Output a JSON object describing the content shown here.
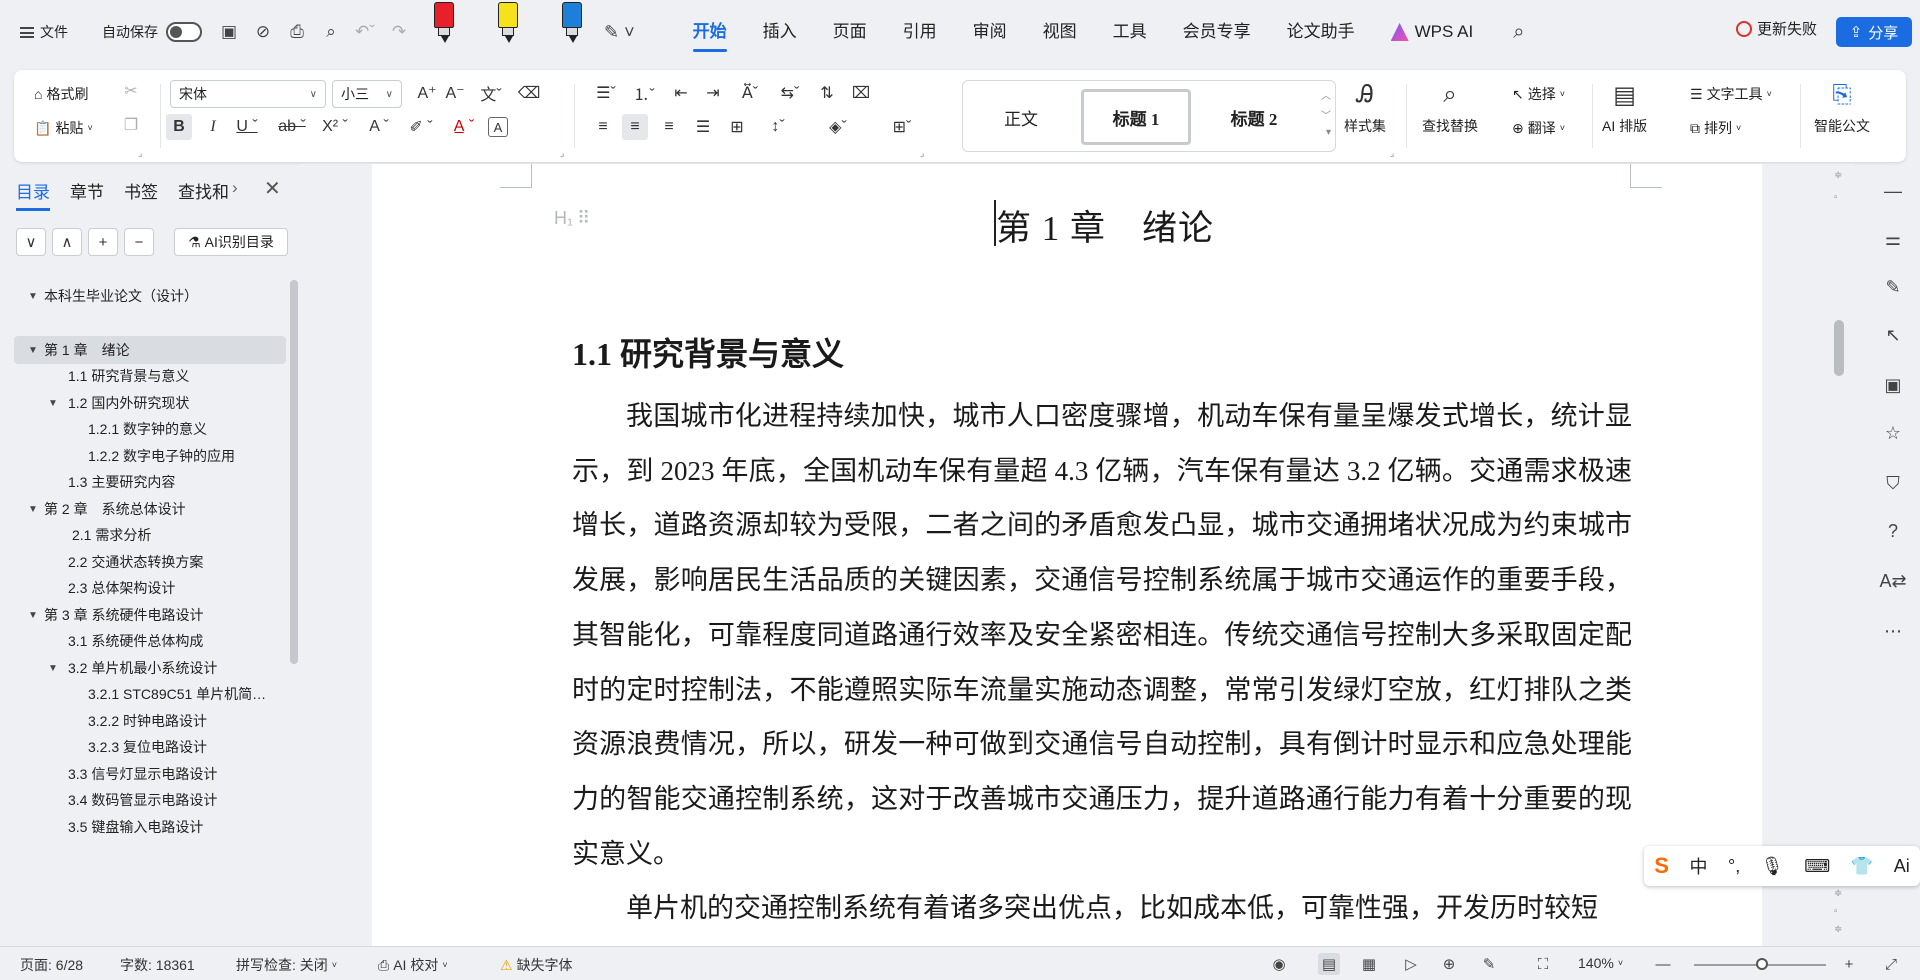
{
  "menubar": {
    "file_label": "文件",
    "autosave_label": "自动保存",
    "autosave_on": false,
    "tabs": [
      "开始",
      "插入",
      "页面",
      "引用",
      "审阅",
      "视图",
      "工具",
      "会员专享",
      "论文助手",
      "WPS AI"
    ],
    "active_tab": "开始",
    "markers": [
      "#e8202a",
      "#f5e21a",
      "#1e7fd8"
    ],
    "update_label": "更新失败",
    "share_label": "分享",
    "accent": "#1a6ce0"
  },
  "ribbon": {
    "format_painter": "格式刷",
    "paste": "粘贴",
    "font_name": "宋体",
    "font_size": "小三",
    "styles": [
      "正文",
      "标题 1",
      "标题 2"
    ],
    "active_style": "标题 1",
    "style_set": "样式集",
    "find_replace": "查找替换",
    "select": "选择",
    "translate": "翻译",
    "ai_layout": "AI 排版",
    "text_tools": "文字工具",
    "arrange": "排列",
    "smart_doc": "智能公文"
  },
  "leftpanel": {
    "tabs": [
      "目录",
      "章节",
      "书签",
      "查找和"
    ],
    "active_tab": "目录",
    "ai_toc_label": "AI识别目录",
    "toc": [
      {
        "label": "本科生毕业论文（设计）",
        "level": 0,
        "expand": "▼"
      },
      {
        "label": "第 1 章　绪论",
        "level": 0,
        "expand": "▼"
      },
      {
        "label": "1.1 研究背景与意义",
        "level": 1,
        "expand": ""
      },
      {
        "label": "1.2 国内外研究现状",
        "level": 1,
        "expand": "▼"
      },
      {
        "label": "1.2.1 数字钟的意义",
        "level": 2,
        "expand": ""
      },
      {
        "label": "1.2.2 数字电子钟的应用",
        "level": 2,
        "expand": ""
      },
      {
        "label": "1.3 主要研究内容",
        "level": 1,
        "expand": ""
      },
      {
        "label": "第 2 章　系统总体设计",
        "level": 0,
        "expand": "▼"
      },
      {
        "label": "2.1  需求分析",
        "level": 1,
        "expand": ""
      },
      {
        "label": "2.2 交通状态转换方案",
        "level": 1,
        "expand": ""
      },
      {
        "label": "2.3 总体架构设计",
        "level": 1,
        "expand": ""
      },
      {
        "label": "第 3 章  系统硬件电路设计",
        "level": 0,
        "expand": "▼"
      },
      {
        "label": "3.1  系统硬件总体构成",
        "level": 1,
        "expand": ""
      },
      {
        "label": "3.2  单片机最小系统设计",
        "level": 1,
        "expand": "▼"
      },
      {
        "label": "3.2.1 STC89C51 单片机简…",
        "level": 2,
        "expand": ""
      },
      {
        "label": "3.2.2  时钟电路设计",
        "level": 2,
        "expand": ""
      },
      {
        "label": "3.2.3  复位电路设计",
        "level": 2,
        "expand": ""
      },
      {
        "label": "3.3  信号灯显示电路设计",
        "level": 1,
        "expand": ""
      },
      {
        "label": "3.4  数码管显示电路设计",
        "level": 1,
        "expand": ""
      },
      {
        "label": "3.5  键盘输入电路设计",
        "level": 1,
        "expand": ""
      }
    ],
    "selected_index": 1
  },
  "document": {
    "chapter_title": "第 1 章　绪论",
    "section_title": "1.1 研究背景与意义",
    "paragraphs": [
      "我国城市化进程持续加快，城市人口密度骤增，机动车保有量呈爆发式增长，统计显示，到 2023 年底，全国机动车保有量超 4.3 亿辆，汽车保有量达 3.2 亿辆。交通需求极速增长，道路资源却较为受限，二者之间的矛盾愈发凸显，城市交通拥堵状况成为约束城市发展，影响居民生活品质的关键因素，交通信号控制系统属于城市交通运作的重要手段，其智能化，可靠程度同道路通行效率及安全紧密相连。传统交通信号控制大多采取固定配时的定时控制法，不能遵照实际车流量实施动态调整，常常引发绿灯空放，红灯排队之类资源浪费情况，所以，研发一种可做到交通信号自动控制，具有倒计时显示和应急处理能力的智能交通控制系统，这对于改善城市交通压力，提升道路通行能力有着十分重要的现实意义。",
      "单片机的交通控制系统有着诸多突出优点，比如成本低，可靠性强，开发历时较短"
    ]
  },
  "ime": {
    "chinese_label": "中",
    "ai_label": "Ai"
  },
  "statusbar": {
    "page": "页面: 6/28",
    "words": "字数: 18361",
    "spellcheck": "拼写检查: 关闭",
    "ai_proof": "AI 校对",
    "missing_font": "缺失字体",
    "zoom": "140%"
  }
}
